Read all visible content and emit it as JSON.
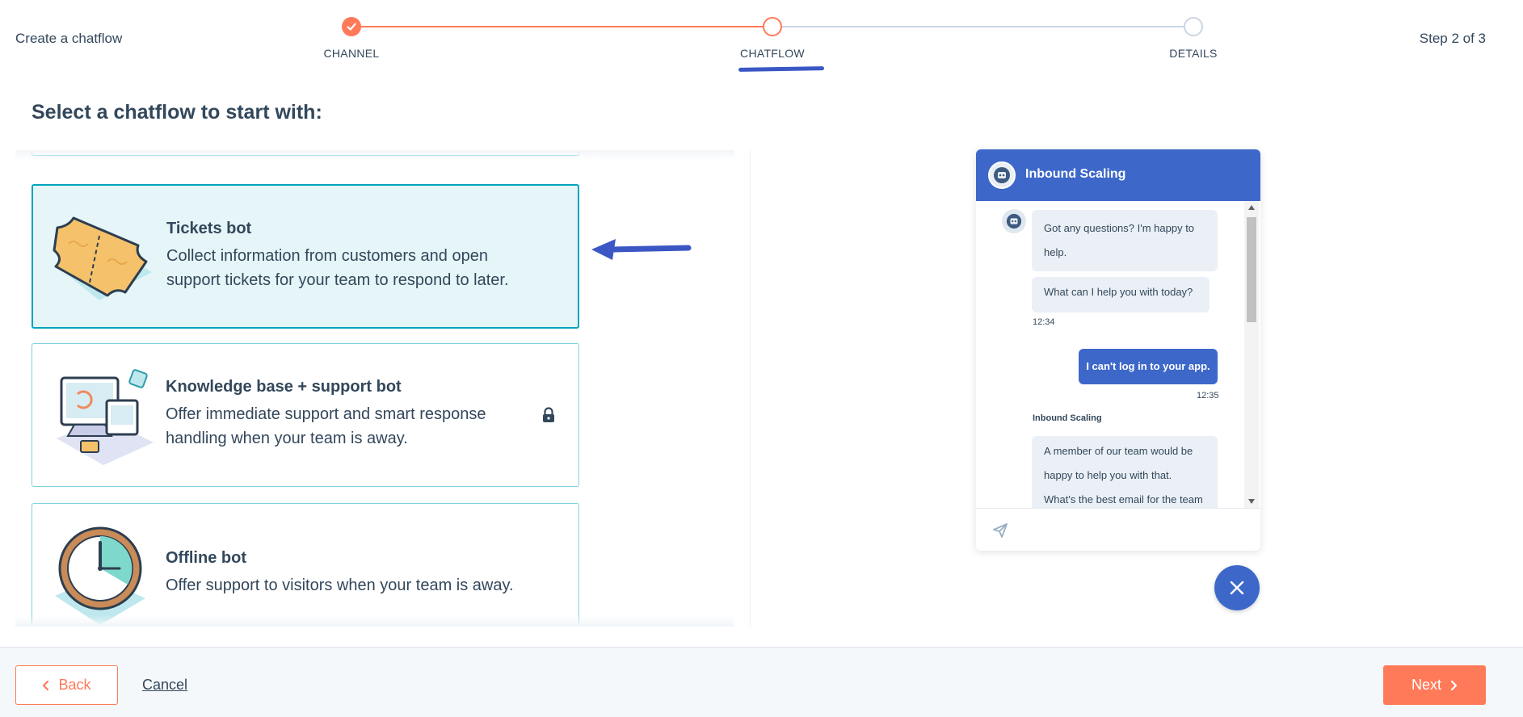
{
  "header": {
    "title": "Create a chatflow",
    "step_counter": "Step 2 of 3",
    "steps": [
      {
        "label": "CHANNEL",
        "state": "done"
      },
      {
        "label": "CHATFLOW",
        "state": "current"
      },
      {
        "label": "DETAILS",
        "state": "todo"
      }
    ]
  },
  "page_heading": "Select a chatflow to start with:",
  "cards": {
    "tickets": {
      "title": "Tickets bot",
      "description": "Collect information from customers and open support tickets for your team to respond to later.",
      "icon": "ticket-icon",
      "selected": true
    },
    "knowledge_base": {
      "title": "Knowledge base + support bot",
      "description": "Offer immediate support and smart response handling when your team is away.",
      "icon": "computer-devices-icon",
      "locked": true
    },
    "offline": {
      "title": "Offline bot",
      "description": "Offer support to visitors when your team is away.",
      "icon": "clock-icon"
    }
  },
  "chat_preview": {
    "header_title": "Inbound Scaling",
    "messages": {
      "bot_1": "Got any questions? I'm happy to help.",
      "bot_2": "What can I help you with today?",
      "time_1": "12:34",
      "user_1": "I can't log in to your app.",
      "time_2": "12:35",
      "sender_name": "Inbound Scaling",
      "bot_3": "A member of our team would be happy to help you with that. What's the best email for the team"
    }
  },
  "footer": {
    "back_label": "Back",
    "cancel_label": "Cancel",
    "next_label": "Next"
  },
  "colors": {
    "accent": "#ff7a59",
    "selected_border": "#00a4bd",
    "chat_blue": "#3d68c9",
    "text": "#33475b"
  }
}
